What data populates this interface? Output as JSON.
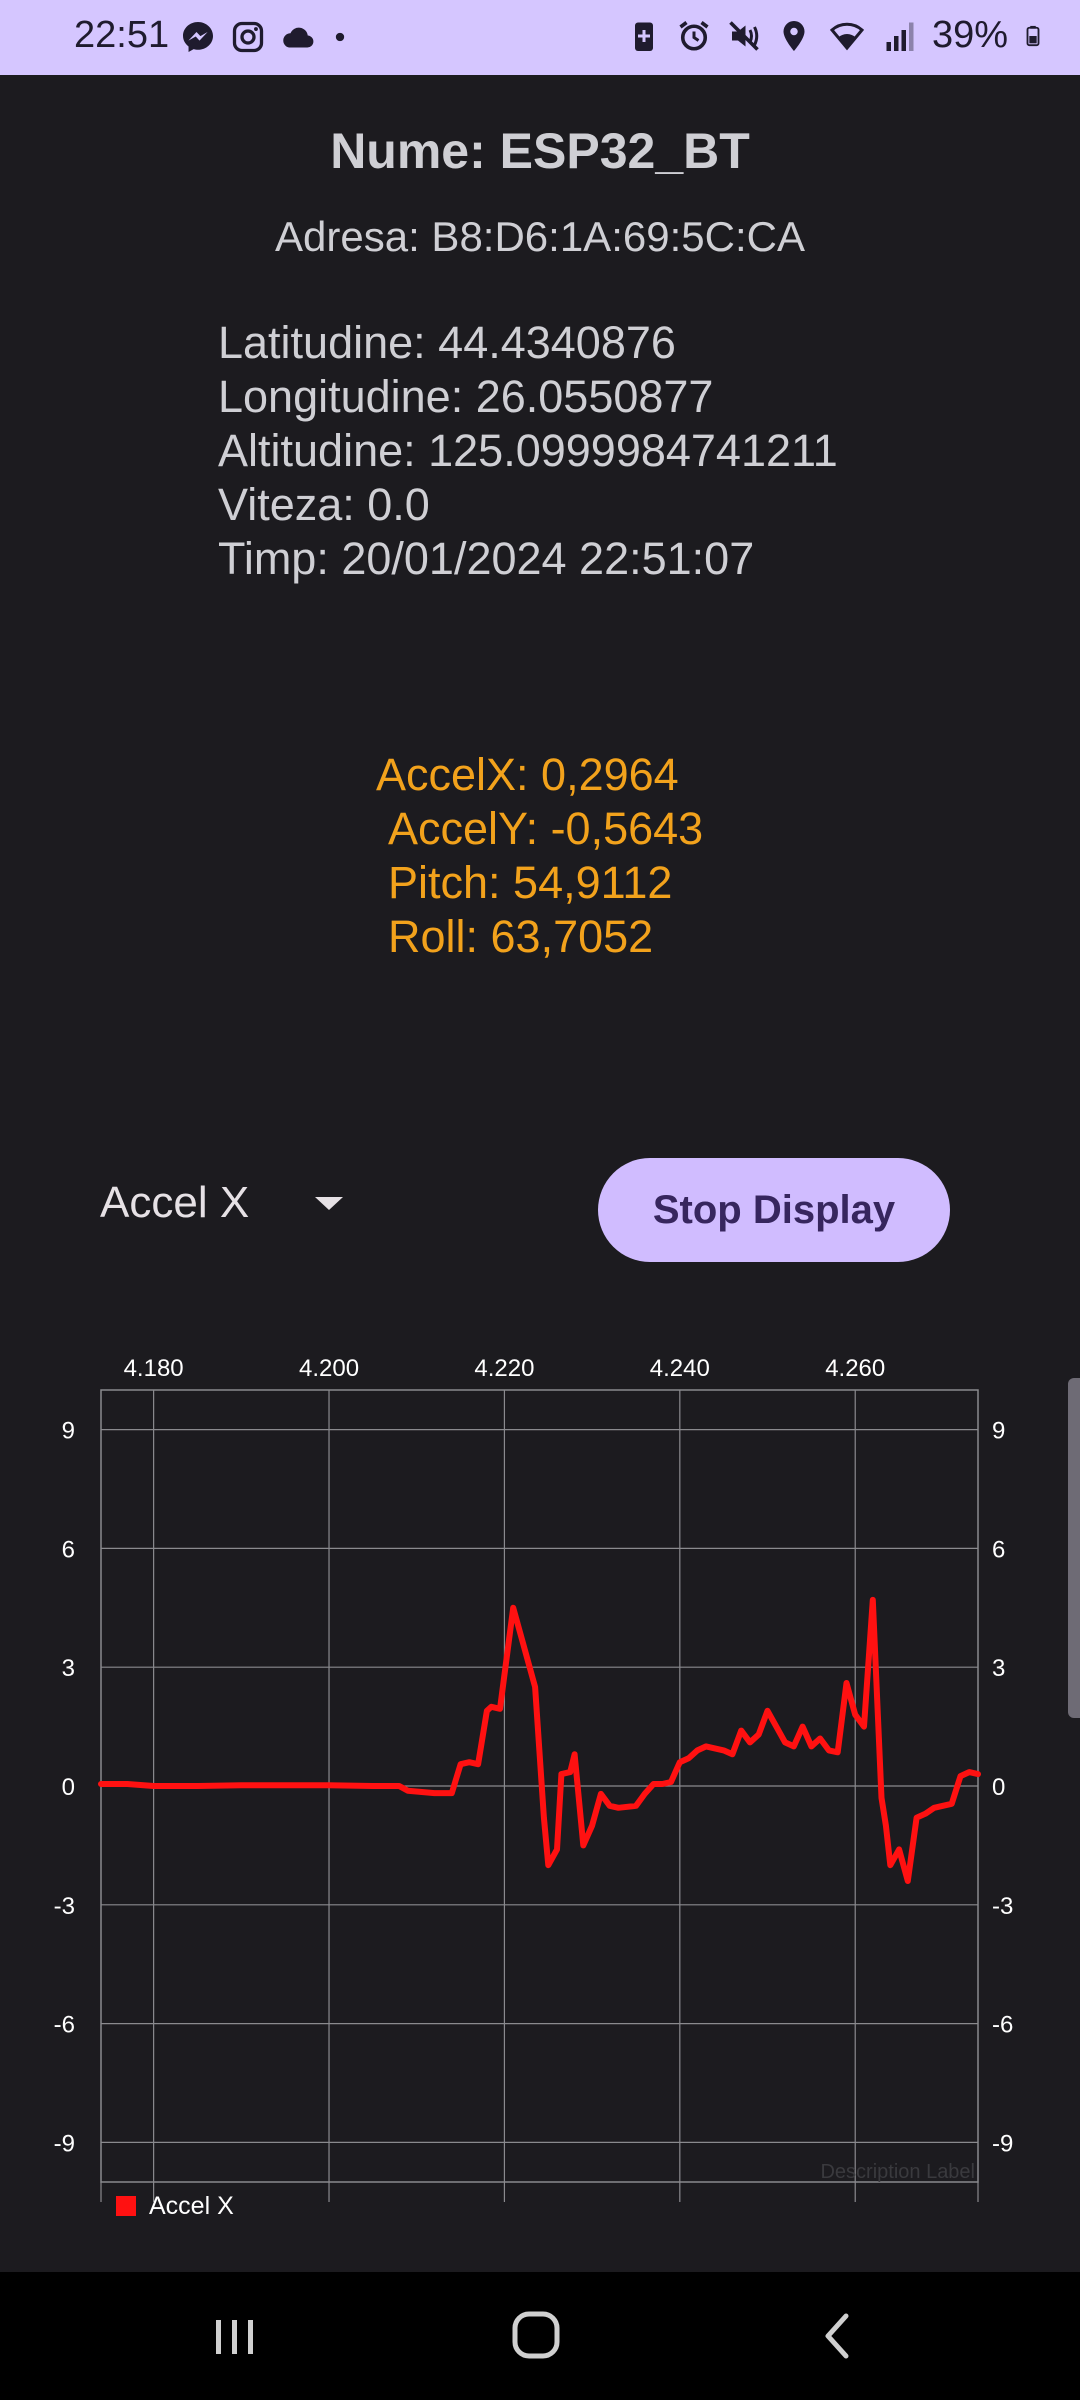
{
  "status_bar": {
    "time": "22:51",
    "battery": "39%",
    "left_icons": [
      "messenger-icon",
      "instagram-icon",
      "cloud-icon",
      "dot-icon"
    ],
    "right_icons": [
      "battery-saver-icon",
      "alarm-icon",
      "mute-icon",
      "location-icon",
      "wifi-icon",
      "signal-icon",
      "battery-icon"
    ]
  },
  "device": {
    "name": "Nume: ESP32_BT",
    "address": "Adresa: B8:D6:1A:69:5C:CA"
  },
  "gps": {
    "latitude": "Latitudine: 44.4340876",
    "longitude": "Longitudine: 26.0550877",
    "altitude": "Altitudine: 125.0999984741211",
    "speed": "Viteza: 0.0",
    "time": "Timp: 20/01/2024 22:51:07"
  },
  "sensor": {
    "accel_x": "AccelX: 0,2964",
    "accel_y": "AccelY: -0,5643",
    "pitch": "Pitch: 54,9112",
    "roll": "Roll: 63,7052"
  },
  "controls": {
    "dropdown_value": "Accel X",
    "stop_button": "Stop Display"
  },
  "chart_data": {
    "type": "line",
    "title": "",
    "xlabel": "",
    "ylabel": "",
    "description_label": "Description Label",
    "x_tick_labels": [
      "4.180",
      "4.200",
      "4.220",
      "4.240",
      "4.260"
    ],
    "x_ticks": [
      4.18,
      4.2,
      4.22,
      4.24,
      4.26
    ],
    "y_tick_labels": [
      "9",
      "6",
      "3",
      "0",
      "-3",
      "-6",
      "-9"
    ],
    "y_ticks": [
      9,
      6,
      3,
      0,
      -3,
      -6,
      -9
    ],
    "xlim": [
      4.174,
      4.274
    ],
    "ylim": [
      -10,
      10
    ],
    "grid": true,
    "legend_position": "bottom-left",
    "series": [
      {
        "name": "Accel X",
        "color": "#ff1111",
        "x": [
          4.174,
          4.177,
          4.18,
          4.185,
          4.19,
          4.195,
          4.2,
          4.205,
          4.208,
          4.209,
          4.212,
          4.214,
          4.215,
          4.216,
          4.217,
          4.218,
          4.2185,
          4.2195,
          4.221,
          4.222,
          4.2235,
          4.2245,
          4.225,
          4.226,
          4.2265,
          4.2275,
          4.228,
          4.229,
          4.23,
          4.231,
          4.232,
          4.233,
          4.235,
          4.236,
          4.237,
          4.238,
          4.239,
          4.24,
          4.241,
          4.242,
          4.243,
          4.244,
          4.245,
          4.246,
          4.247,
          4.248,
          4.249,
          4.25,
          4.251,
          4.252,
          4.253,
          4.254,
          4.255,
          4.256,
          4.257,
          4.258,
          4.259,
          4.26,
          4.261,
          4.262,
          4.263,
          4.2635,
          4.264,
          4.265,
          4.266,
          4.267,
          4.268,
          4.269,
          4.27,
          4.271,
          4.272,
          4.273,
          4.274
        ],
        "values": [
          0.05,
          0.05,
          0.0,
          0.0,
          0.02,
          0.02,
          0.02,
          0.0,
          0.0,
          -0.12,
          -0.18,
          -0.18,
          0.55,
          0.6,
          0.55,
          1.9,
          2.0,
          1.95,
          4.5,
          3.7,
          2.5,
          -0.8,
          -2.0,
          -1.6,
          0.3,
          0.35,
          0.8,
          -1.5,
          -1.0,
          -0.2,
          -0.5,
          -0.55,
          -0.5,
          -0.2,
          0.05,
          0.05,
          0.1,
          0.6,
          0.7,
          0.9,
          1.0,
          0.95,
          0.9,
          0.8,
          1.4,
          1.1,
          1.3,
          1.9,
          1.5,
          1.1,
          1.0,
          1.5,
          1.0,
          1.2,
          0.9,
          0.85,
          2.6,
          1.8,
          1.5,
          4.7,
          -0.3,
          -1.0,
          -2.0,
          -1.6,
          -2.4,
          -0.8,
          -0.7,
          -0.55,
          -0.5,
          -0.45,
          0.25,
          0.35,
          0.3
        ]
      }
    ]
  }
}
